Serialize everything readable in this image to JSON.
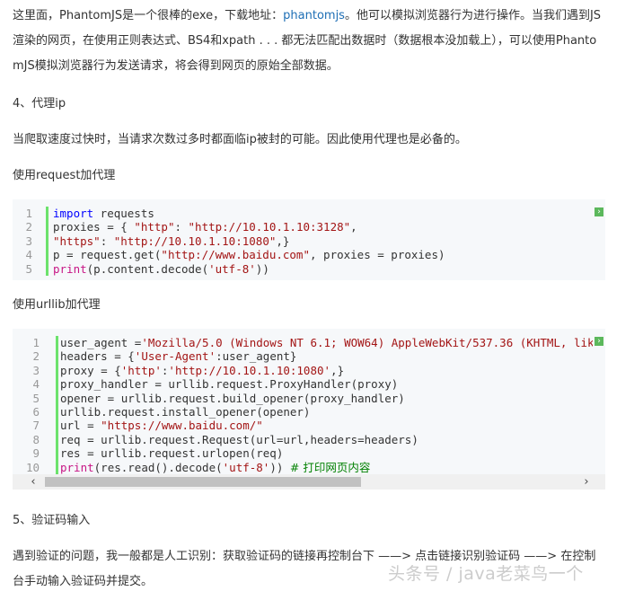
{
  "intro": {
    "line1_before": "这里面，PhantomJS是一个很棒的exe，下载地址：",
    "link": "phantomjs",
    "line1_after": "。他可以模拟浏览器行为进行操作。当我们遇到JS",
    "line2": "渲染的网页，在使用正则表达式、BS4和xpath . . . 都无法匹配出数据时（数据根本没加载上），可以使用Phanto",
    "line3": "mJS模拟浏览器行为发送请求，将会得到网页的原始全部数据。"
  },
  "section4": {
    "heading": "4、代理ip",
    "desc": "当爬取速度过快时，当请求次数过多时都面临ip被封的可能。因此使用代理也是必备的。",
    "request_label": "使用request加代理",
    "urllib_label": "使用urllib加代理"
  },
  "code1": {
    "line_numbers": [
      "1",
      "2",
      "3",
      "4",
      "5"
    ],
    "l1_kw": "import",
    "l1_rest": " requests",
    "l2_a": "proxies = { ",
    "l2_s1": "\"http\"",
    "l2_b": ": ",
    "l2_s2": "\"http://10.10.1.10:3128\"",
    "l2_c": ",",
    "l3_s1": "\"https\"",
    "l3_b": ": ",
    "l3_s2": "\"http://10.10.1.10:1080\"",
    "l3_c": ",}",
    "l4_a": "p = request.get(",
    "l4_s1": "\"http://www.baidu.com\"",
    "l4_b": ", proxies = proxies)",
    "l5_fn": "print",
    "l5_a": "(p.content.decode(",
    "l5_s": "'utf-8'",
    "l5_b": "))"
  },
  "code2": {
    "line_numbers": [
      "1",
      "2",
      "3",
      "4",
      "5",
      "6",
      "7",
      "8",
      "9",
      "10"
    ],
    "l1_a": "user_agent =",
    "l1_s": "'Mozilla/5.0 (Windows NT 6.1; WOW64) AppleWebKit/537.36 (KHTML, lik",
    "l2_a": "headers = {",
    "l2_s": "'User-Agent'",
    "l2_b": ":user_agent}",
    "l3_a": "proxy = {",
    "l3_s1": "'http'",
    "l3_b": ":",
    "l3_s2": "'http://10.10.1.10:1080'",
    "l3_c": ",}",
    "l4": "proxy_handler = urllib.request.ProxyHandler(proxy)",
    "l5": "opener = urllib.request.build_opener(proxy_handler)",
    "l6": "urllib.request.install_opener(opener)",
    "l7_a": "url = ",
    "l7_s": "\"https://www.baidu.com/\"",
    "l8": "req = urllib.request.Request(url=url,headers=headers)",
    "l9": "res = urllib.request.urlopen(req)",
    "l10_fn": "print",
    "l10_a": "(res.read().decode(",
    "l10_s": "'utf-8'",
    "l10_b": ")) ",
    "l10_cm": "# 打印网页内容"
  },
  "scroll": {
    "left_arrow": "‹",
    "right_arrow": "›"
  },
  "section5": {
    "heading": "5、验证码输入",
    "line1": "遇到验证的问题，我一般都是人工识别：获取验证码的链接再控制台下 ——> 点击链接识别验证码 ——> 在控制",
    "line2": "台手动输入验证码并提交。"
  },
  "watermark": "头条号 / java老菜鸟一个"
}
